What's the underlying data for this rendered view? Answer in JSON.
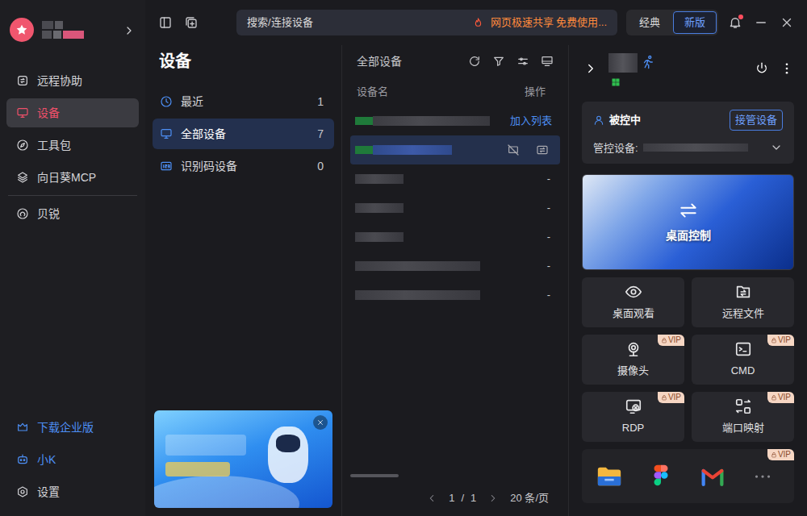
{
  "sidebar": {
    "items": [
      {
        "label": "远程协助",
        "selected": false
      },
      {
        "label": "设备",
        "selected": true
      },
      {
        "label": "工具包",
        "selected": false
      },
      {
        "label": "向日葵MCP",
        "selected": false
      },
      {
        "label": "贝锐",
        "selected": false
      }
    ],
    "footer": [
      {
        "label": "下载企业版",
        "kind": "link"
      },
      {
        "label": "小K",
        "kind": "link"
      },
      {
        "label": "设置",
        "kind": "plain"
      }
    ]
  },
  "topbar": {
    "search": {
      "placeholder": "搜索/连接设备"
    },
    "promo": "网页极速共享 免费使用...",
    "modes": [
      {
        "label": "经典",
        "selected": false
      },
      {
        "label": "新版",
        "selected": true
      }
    ],
    "notifications": {
      "unread": true
    }
  },
  "categories": {
    "title": "设备",
    "items": [
      {
        "label": "最近",
        "count": "1",
        "selected": false
      },
      {
        "label": "全部设备",
        "count": "7",
        "selected": true
      },
      {
        "label": "识别码设备",
        "count": "0",
        "selected": false
      }
    ]
  },
  "device_list": {
    "title": "全部设备",
    "columns": [
      "设备名",
      "操作"
    ],
    "rows": [
      {
        "online": true,
        "selected": false,
        "kind": "action",
        "action": "加入列表"
      },
      {
        "online": true,
        "selected": true,
        "kind": "tools"
      },
      {
        "online": false,
        "selected": false,
        "kind": "action",
        "action": "-"
      },
      {
        "online": false,
        "selected": false,
        "kind": "action",
        "action": "-"
      },
      {
        "online": false,
        "selected": false,
        "kind": "action",
        "action": "-"
      },
      {
        "online": false,
        "selected": false,
        "kind": "action",
        "action": "-"
      },
      {
        "online": false,
        "selected": false,
        "kind": "action",
        "action": "-"
      }
    ],
    "pagination": {
      "page": "1",
      "separator": "/",
      "total": "1",
      "page_size": "20 条/页"
    }
  },
  "device_panel": {
    "status": "被控中",
    "takeover_button": "接管设备",
    "managed_label": "管控设备:",
    "primary": {
      "label": "桌面控制"
    },
    "vip_label": "VIP",
    "features": [
      {
        "label": "桌面观看",
        "vip": false
      },
      {
        "label": "远程文件",
        "vip": false
      },
      {
        "label": "摄像头",
        "vip": true
      },
      {
        "label": "CMD",
        "vip": true
      },
      {
        "label": "RDP",
        "vip": true
      },
      {
        "label": "端口映射",
        "vip": true
      }
    ],
    "apps": {
      "vip": true
    }
  }
}
